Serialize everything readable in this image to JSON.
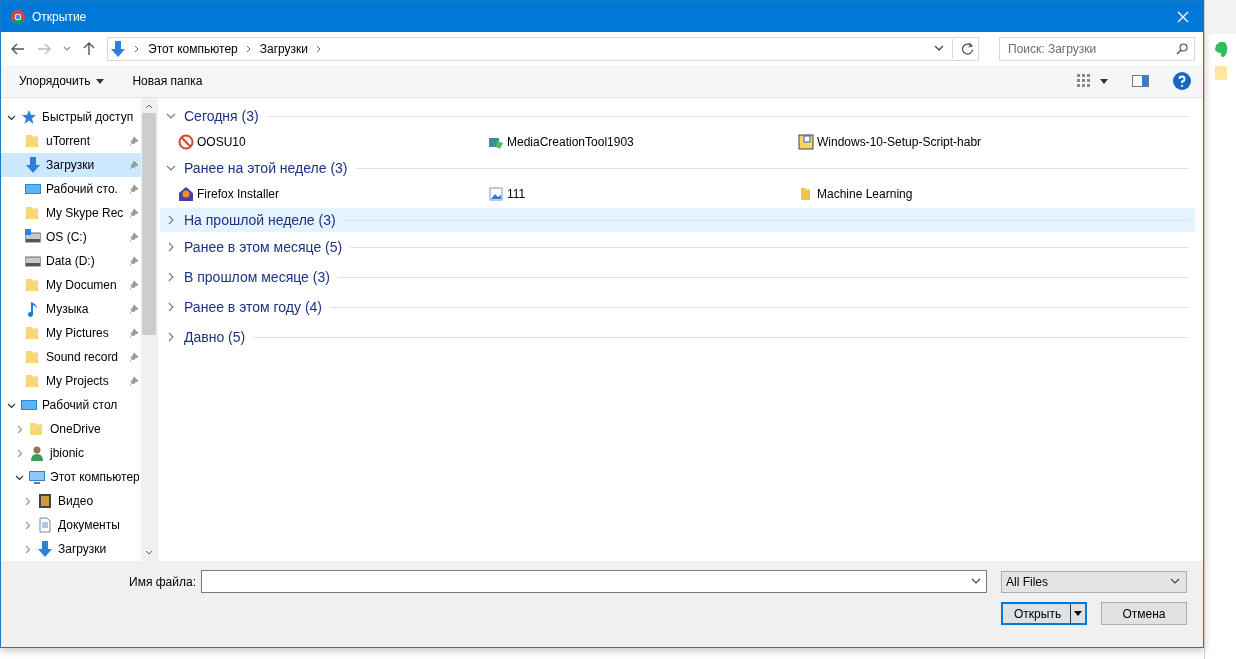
{
  "window": {
    "title": "Открытие"
  },
  "nav": {
    "path": [
      "Этот компьютер",
      "Загрузки"
    ],
    "search_placeholder": "Поиск: Загрузки"
  },
  "toolbar": {
    "organize": "Упорядочить",
    "new_folder": "Новая папка"
  },
  "sidebar": [
    {
      "label": "Быстрый доступ",
      "kind": "star",
      "expanded": true,
      "selected": false,
      "children": [
        {
          "label": "uTorrent",
          "kind": "folder",
          "pinned": true,
          "selected": false
        },
        {
          "label": "Загрузки",
          "kind": "download",
          "pinned": true,
          "selected": true
        },
        {
          "label": "Рабочий сто.",
          "kind": "desktop",
          "pinned": true,
          "selected": false
        },
        {
          "label": "My Skype Rec",
          "kind": "folder",
          "pinned": true,
          "selected": false
        },
        {
          "label": "OS (C:)",
          "kind": "osdrive",
          "pinned": true,
          "selected": false
        },
        {
          "label": "Data (D:)",
          "kind": "drive",
          "pinned": true,
          "selected": false
        },
        {
          "label": "My Documen",
          "kind": "folder",
          "pinned": true,
          "selected": false
        },
        {
          "label": "Музыка",
          "kind": "music",
          "pinned": true,
          "selected": false
        },
        {
          "label": "My Pictures",
          "kind": "folder",
          "pinned": true,
          "selected": false
        },
        {
          "label": "Sound record",
          "kind": "folder",
          "pinned": true,
          "selected": false
        },
        {
          "label": "My Projects",
          "kind": "folder",
          "pinned": true,
          "selected": false
        }
      ]
    },
    {
      "label": "Рабочий стол",
      "kind": "desktop",
      "expanded": true,
      "selected": false,
      "children": [
        {
          "label": "OneDrive",
          "kind": "folder",
          "expanded": false,
          "selected": false
        },
        {
          "label": "jbionic",
          "kind": "person",
          "expanded": false,
          "selected": false
        },
        {
          "label": "Этот компьютер",
          "kind": "computer",
          "expanded": true,
          "selected": false,
          "children": [
            {
              "label": "Видео",
              "kind": "video",
              "expanded": false,
              "selected": false
            },
            {
              "label": "Документы",
              "kind": "document",
              "expanded": false,
              "selected": false
            },
            {
              "label": "Загрузки",
              "kind": "download",
              "expanded": false,
              "selected": false
            }
          ]
        }
      ]
    }
  ],
  "groups": [
    {
      "label": "Сегодня (3)",
      "expanded": true,
      "selected": false,
      "files": [
        {
          "name": "OOSU10",
          "kind": "blocked"
        },
        {
          "name": "MediaCreationTool1903",
          "kind": "setup"
        },
        {
          "name": "Windows-10-Setup-Script-habr",
          "kind": "archive"
        }
      ]
    },
    {
      "label": "Ранее на этой неделе (3)",
      "expanded": true,
      "selected": false,
      "files": [
        {
          "name": "Firefox Installer",
          "kind": "installer"
        },
        {
          "name": "111",
          "kind": "image"
        },
        {
          "name": "Machine Learning",
          "kind": "folder"
        }
      ]
    },
    {
      "label": "На прошлой неделе (3)",
      "expanded": false,
      "selected": true
    },
    {
      "label": "Ранее в этом месяце (5)",
      "expanded": false,
      "selected": false
    },
    {
      "label": "В прошлом месяце (3)",
      "expanded": false,
      "selected": false
    },
    {
      "label": "Ранее в этом году (4)",
      "expanded": false,
      "selected": false
    },
    {
      "label": "Давно (5)",
      "expanded": false,
      "selected": false
    }
  ],
  "footer": {
    "filename_label": "Имя файла:",
    "filter": "All Files",
    "open": "Открыть",
    "cancel": "Отмена"
  }
}
